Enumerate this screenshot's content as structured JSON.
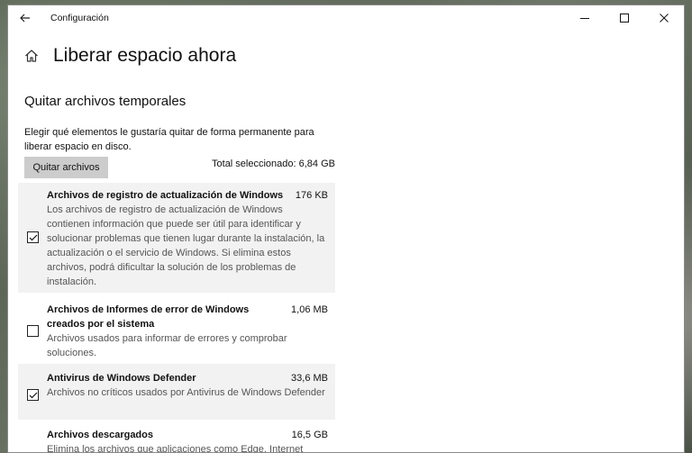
{
  "window": {
    "title": "Configuración",
    "back_icon": "arrow-left-icon",
    "minimize_icon": "minimize-icon",
    "maximize_icon": "maximize-icon",
    "close_icon": "close-icon"
  },
  "page": {
    "home_icon": "home-icon",
    "title": "Liberar espacio ahora",
    "section_title": "Quitar archivos temporales",
    "description": "Elegir qué elementos le gustaría quitar de forma permanente para liberar espacio en disco.",
    "remove_button": "Quitar archivos",
    "total_selected": "Total seleccionado: 6,84 GB"
  },
  "items": [
    {
      "name": "Archivos de registro de actualización de Windows",
      "size": "176 KB",
      "description": "Los archivos de registro de actualización de Windows contienen información que puede ser útil para identificar y solucionar problemas que tienen lugar durante la instalación, la actualización o el servicio de Windows. Si elimina estos archivos, podrá dificultar la solución de los problemas de instalación.",
      "checked": true
    },
    {
      "name": "Archivos de Informes de error de Windows creados por el sistema",
      "size": "1,06 MB",
      "description": "Archivos usados para informar de errores y comprobar soluciones.",
      "checked": false
    },
    {
      "name": "Antivirus de Windows Defender",
      "size": "33,6 MB",
      "description": "Archivos no críticos usados por Antivirus de Windows Defender",
      "checked": true
    },
    {
      "name": "Archivos descargados",
      "size": "16,5 GB",
      "description": "Elimina los archivos que aplicaciones como Edge, Internet",
      "checked": false
    }
  ],
  "colors": {
    "selected_row": "#f2f2f2",
    "button_bg": "#cccccc",
    "muted_text": "#555555"
  }
}
